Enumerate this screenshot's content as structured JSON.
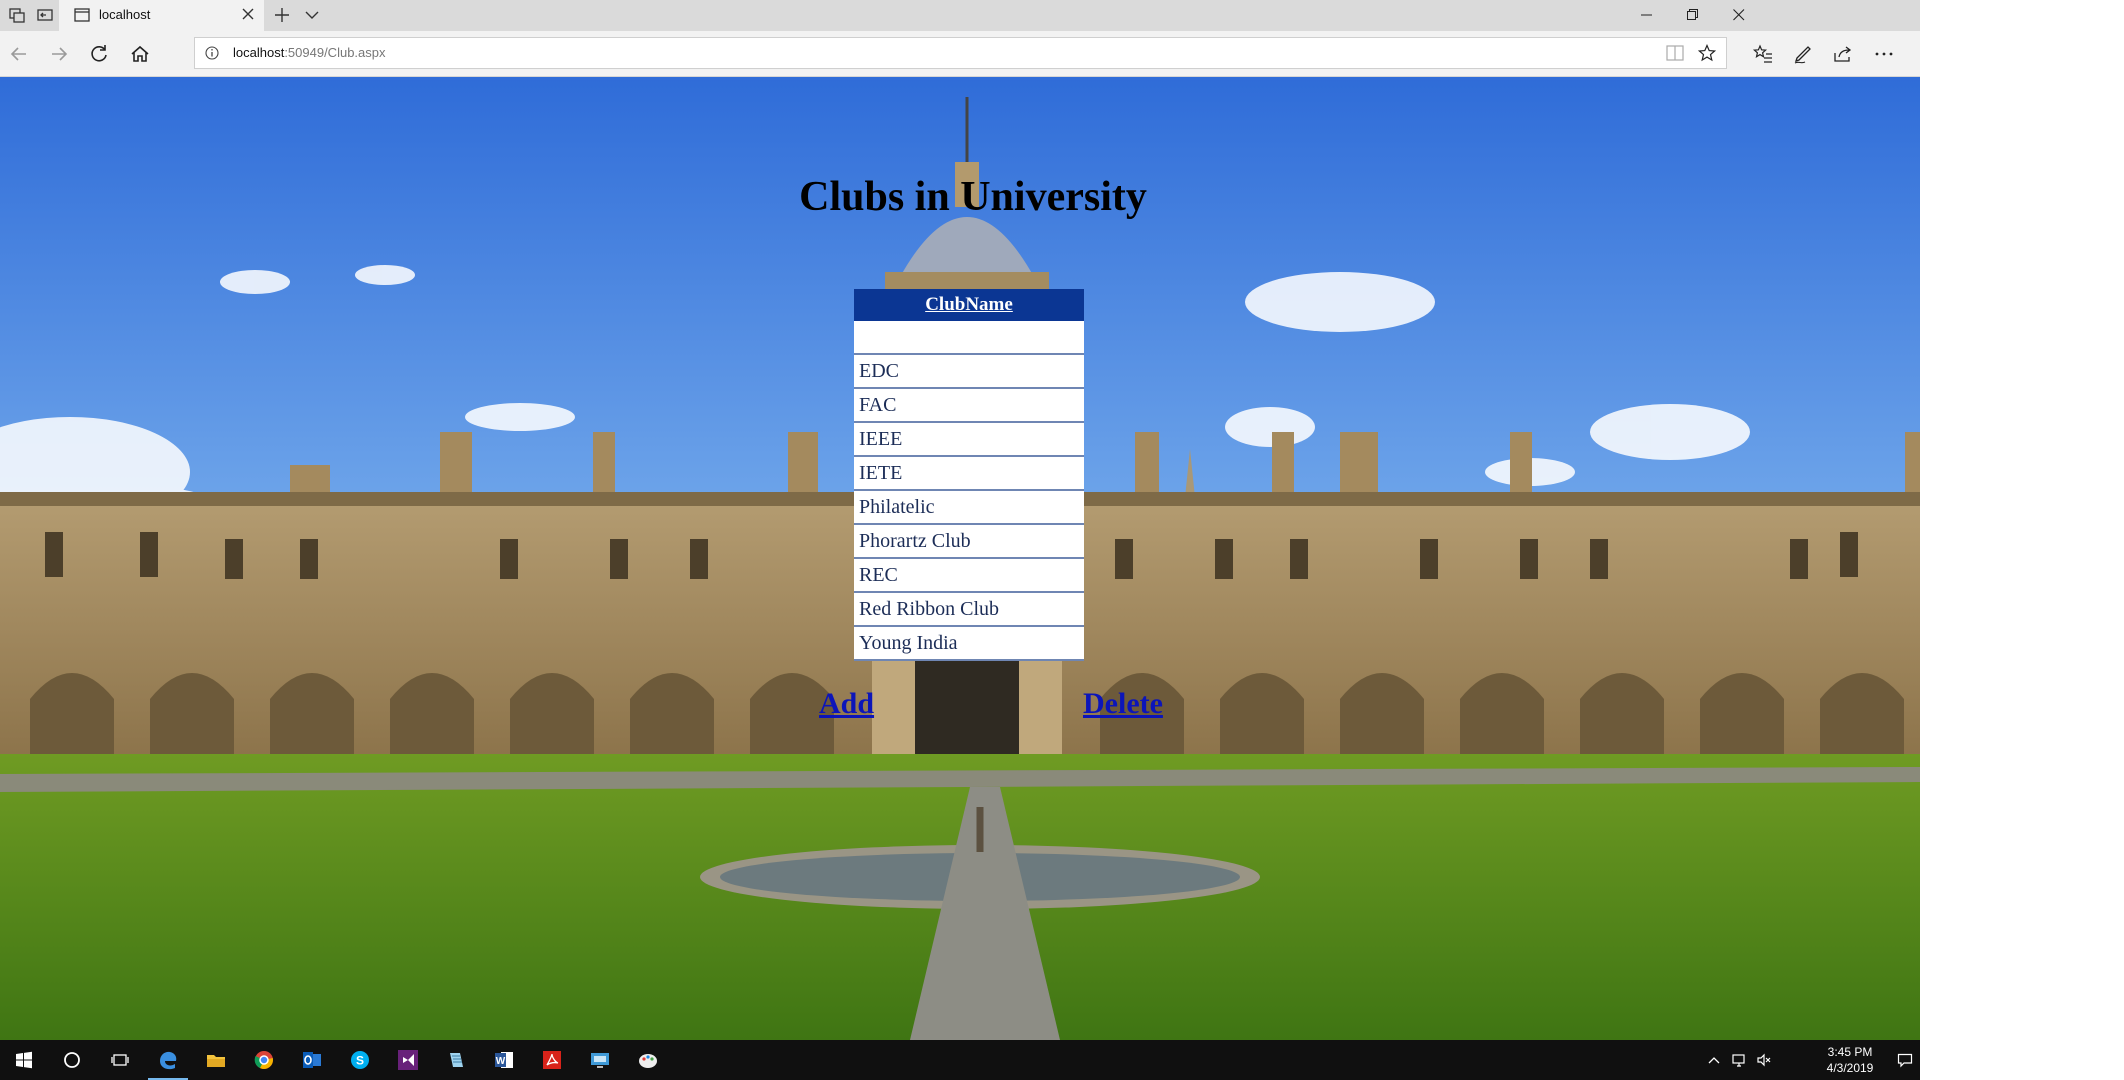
{
  "browser": {
    "tab_title": "localhost",
    "url_host": "localhost",
    "url_path": ":50949/Club.aspx"
  },
  "page": {
    "heading": "Clubs in University",
    "table_header": "ClubName",
    "clubs": [
      "",
      "EDC",
      "FAC",
      "IEEE",
      "IETE",
      "Philatelic",
      "Phorartz Club",
      "REC",
      "Red Ribbon Club",
      "Young India"
    ],
    "add_label": "Add",
    "delete_label": "Delete"
  },
  "taskbar": {
    "apps": [
      "windows-start-icon",
      "cortana-search-icon",
      "task-view-icon",
      "edge-browser-icon",
      "file-explorer-icon",
      "chrome-icon",
      "outlook-icon",
      "skype-icon",
      "visual-studio-icon",
      "notepad-icon",
      "word-icon",
      "acrobat-reader-icon",
      "remote-desktop-icon",
      "paint-icon"
    ],
    "clock_time": "3:45 PM",
    "clock_date": "4/3/2019"
  },
  "colors": {
    "table_header_bg": "#0b3693",
    "link_color": "#0c15b9",
    "taskbar_bg": "#101010"
  }
}
